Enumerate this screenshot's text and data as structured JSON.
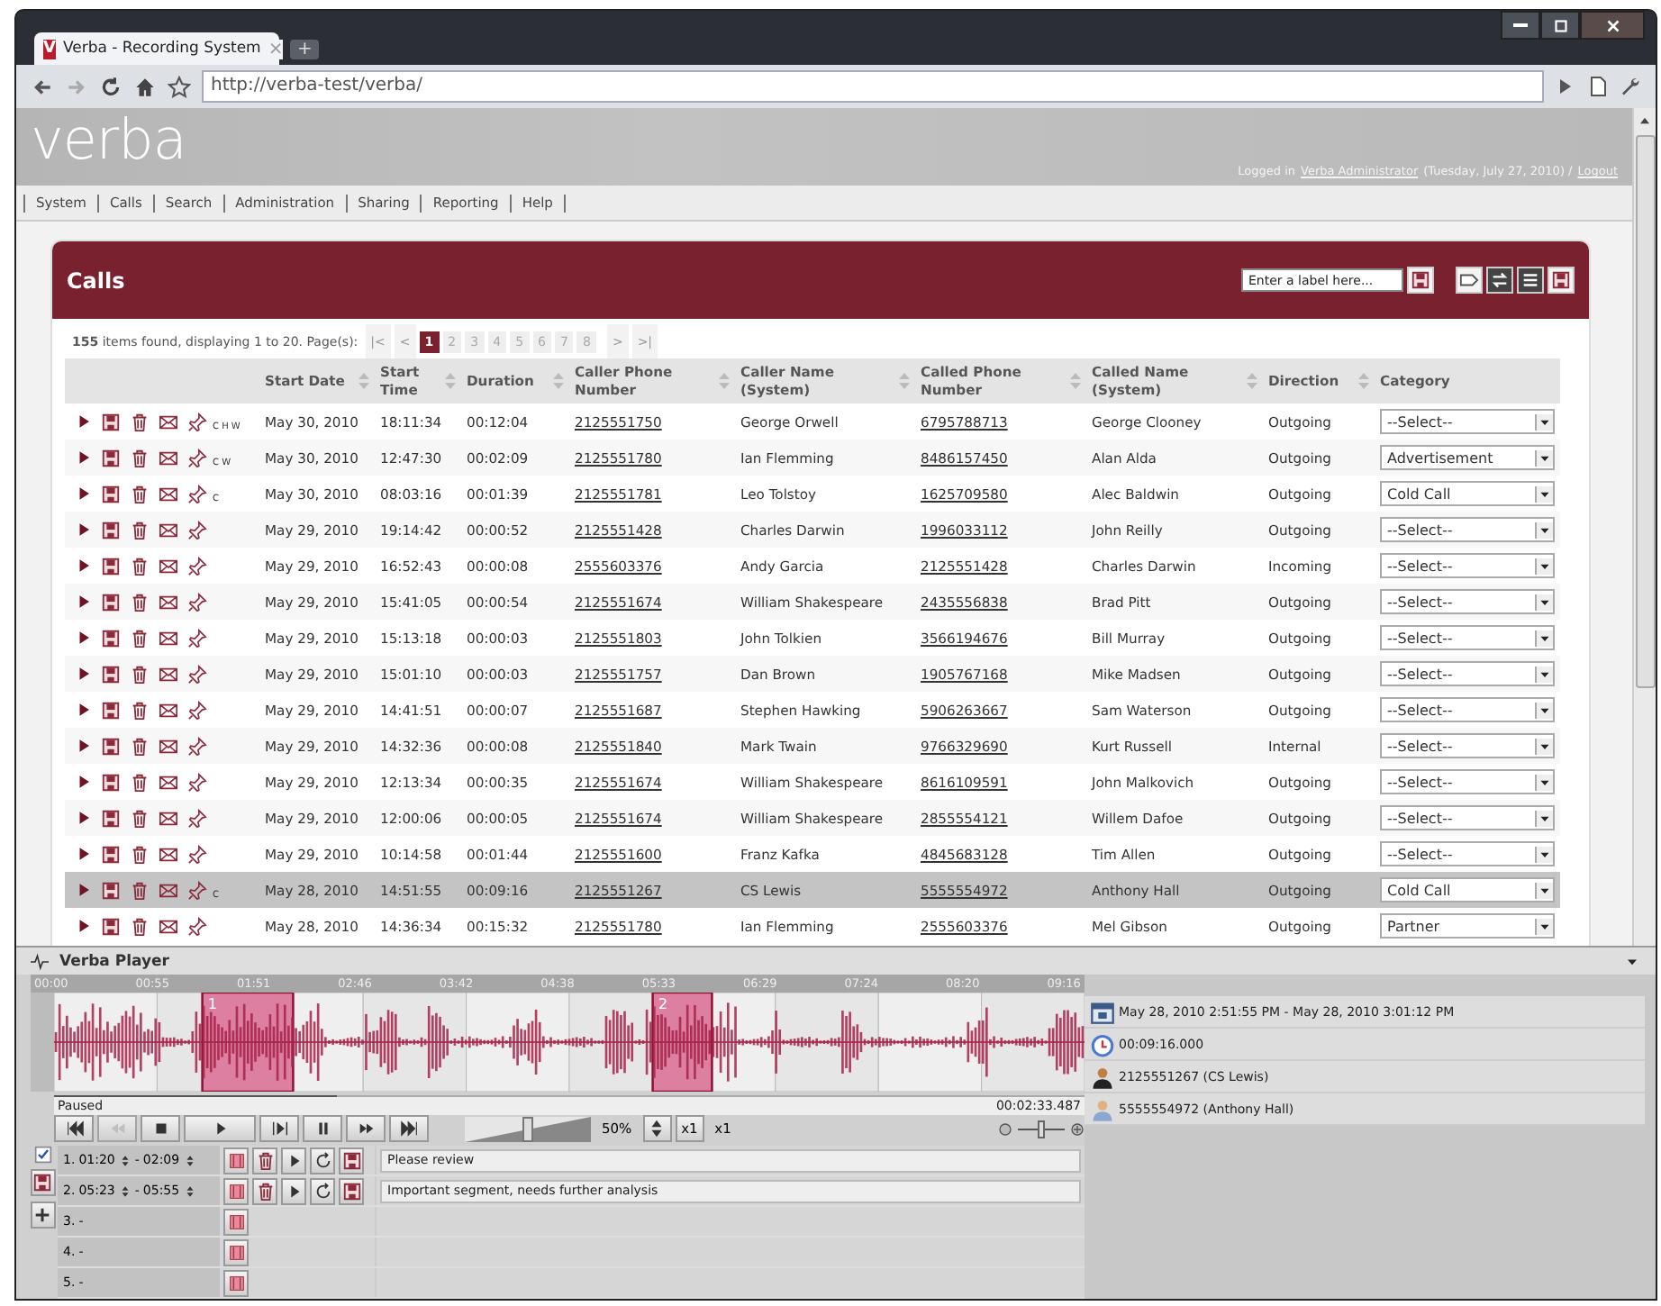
{
  "browser": {
    "tab_logo": "V",
    "tab_title": "Verba - Recording System",
    "tab_close": "×",
    "new_tab": "+",
    "url": "http://verba-test/verba/"
  },
  "header": {
    "logo": "verba",
    "logged_in": "Logged in",
    "user": "Verba Administrator",
    "date": "(Tuesday, July 27, 2010) /",
    "logout": "Logout"
  },
  "nav": [
    "System",
    "Calls",
    "Search",
    "Administration",
    "Sharing",
    "Reporting",
    "Help"
  ],
  "calls": {
    "title": "Calls",
    "label_field": {
      "placeholder": "Enter a label here..."
    },
    "summary": "**155** items found, displaying 1 to 20. Page(s):",
    "pager": [
      {
        "label": "|<",
        "kind": "nav",
        "selected": false
      },
      {
        "label": "<",
        "kind": "nav",
        "selected": false
      },
      {
        "label": "1",
        "kind": "page",
        "selected": true
      },
      {
        "label": "2",
        "kind": "page",
        "selected": false
      },
      {
        "label": "3",
        "kind": "page",
        "selected": false
      },
      {
        "label": "4",
        "kind": "page",
        "selected": false
      },
      {
        "label": "5",
        "kind": "page",
        "selected": false
      },
      {
        "label": "6",
        "kind": "page",
        "selected": false
      },
      {
        "label": "7",
        "kind": "page",
        "selected": false
      },
      {
        "label": "8",
        "kind": "page",
        "selected": false
      },
      {
        "label": ">",
        "kind": "nav",
        "selected": false
      },
      {
        "label": ">|",
        "kind": "nav",
        "selected": false
      }
    ],
    "columns": [
      {
        "label": "Start Date",
        "sortable": true
      },
      {
        "label": "Start Time",
        "sortable": true
      },
      {
        "label": "Duration",
        "sortable": true
      },
      {
        "label": "Caller Phone Number",
        "sortable": true
      },
      {
        "label": "Caller Name (System)",
        "sortable": true
      },
      {
        "label": "Called Phone Number",
        "sortable": true
      },
      {
        "label": "Called Name (System)",
        "sortable": true
      },
      {
        "label": "Direction",
        "sortable": true
      },
      {
        "label": "Category",
        "sortable": false
      }
    ],
    "rows": [
      {
        "flags": "C H W",
        "start_date": "May 30, 2010",
        "start_time": "18:11:34",
        "duration": "00:12:04",
        "caller_phone": "2125551750",
        "caller_name": "George Orwell",
        "called_phone": "6795788713",
        "called_name": "George Clooney",
        "direction": "Outgoing",
        "category": "--Select--",
        "selected": false
      },
      {
        "flags": "C W",
        "start_date": "May 30, 2010",
        "start_time": "12:47:30",
        "duration": "00:02:09",
        "caller_phone": "2125551780",
        "caller_name": "Ian Flemming",
        "called_phone": "8486157450",
        "called_name": "Alan Alda",
        "direction": "Outgoing",
        "category": "Advertisement",
        "selected": false
      },
      {
        "flags": "C",
        "start_date": "May 30, 2010",
        "start_time": "08:03:16",
        "duration": "00:01:39",
        "caller_phone": "2125551781",
        "caller_name": "Leo Tolstoy",
        "called_phone": "1625709580",
        "called_name": "Alec Baldwin",
        "direction": "Outgoing",
        "category": "Cold Call",
        "selected": false
      },
      {
        "start_date": "May 29, 2010",
        "start_time": "19:14:42",
        "duration": "00:00:52",
        "caller_phone": "2125551428",
        "caller_name": "Charles Darwin",
        "called_phone": "1996033112",
        "called_name": "John Reilly",
        "direction": "Outgoing",
        "category": "--Select--",
        "selected": false
      },
      {
        "start_date": "May 29, 2010",
        "start_time": "16:52:43",
        "duration": "00:00:08",
        "caller_phone": "2555603376",
        "caller_name": "Andy Garcia",
        "called_phone": "2125551428",
        "called_name": "Charles Darwin",
        "direction": "Incoming",
        "category": "--Select--",
        "selected": false
      },
      {
        "start_date": "May 29, 2010",
        "start_time": "15:41:05",
        "duration": "00:00:54",
        "caller_phone": "2125551674",
        "caller_name": "William Shakespeare",
        "called_phone": "2435556838",
        "called_name": "Brad Pitt",
        "direction": "Outgoing",
        "category": "--Select--",
        "selected": false
      },
      {
        "start_date": "May 29, 2010",
        "start_time": "15:13:18",
        "duration": "00:00:03",
        "caller_phone": "2125551803",
        "caller_name": "John Tolkien",
        "called_phone": "3566194676",
        "called_name": "Bill Murray",
        "direction": "Outgoing",
        "category": "--Select--",
        "selected": false
      },
      {
        "start_date": "May 29, 2010",
        "start_time": "15:01:10",
        "duration": "00:00:03",
        "caller_phone": "2125551757",
        "caller_name": "Dan Brown",
        "called_phone": "1905767168",
        "called_name": "Mike Madsen",
        "direction": "Outgoing",
        "category": "--Select--",
        "selected": false
      },
      {
        "start_date": "May 29, 2010",
        "start_time": "14:41:51",
        "duration": "00:00:07",
        "caller_phone": "2125551687",
        "caller_name": "Stephen Hawking",
        "called_phone": "5906263667",
        "called_name": "Sam Waterson",
        "direction": "Outgoing",
        "category": "--Select--",
        "selected": false
      },
      {
        "start_date": "May 29, 2010",
        "start_time": "14:32:36",
        "duration": "00:00:08",
        "caller_phone": "2125551840",
        "caller_name": "Mark Twain",
        "called_phone": "9766329690",
        "called_name": "Kurt Russell",
        "direction": "Internal",
        "category": "--Select--",
        "selected": false
      },
      {
        "start_date": "May 29, 2010",
        "start_time": "12:13:34",
        "duration": "00:00:35",
        "caller_phone": "2125551674",
        "caller_name": "William Shakespeare",
        "called_phone": "8616109591",
        "called_name": "John Malkovich",
        "direction": "Outgoing",
        "category": "--Select--",
        "selected": false
      },
      {
        "start_date": "May 29, 2010",
        "start_time": "12:00:06",
        "duration": "00:00:05",
        "caller_phone": "2125551674",
        "caller_name": "William Shakespeare",
        "called_phone": "2855554121",
        "called_name": "Willem Dafoe",
        "direction": "Outgoing",
        "category": "--Select--",
        "selected": false
      },
      {
        "start_date": "May 29, 2010",
        "start_time": "10:14:58",
        "duration": "00:01:44",
        "caller_phone": "2125551600",
        "caller_name": "Franz Kafka",
        "called_phone": "4845683128",
        "called_name": "Tim Allen",
        "direction": "Outgoing",
        "category": "--Select--",
        "selected": false
      },
      {
        "flags": "C",
        "start_date": "May 28, 2010",
        "start_time": "14:51:55",
        "duration": "00:09:16",
        "caller_phone": "2125551267",
        "caller_name": "CS Lewis",
        "called_phone": "5555554972",
        "called_name": "Anthony Hall",
        "direction": "Outgoing",
        "category": "Cold Call",
        "selected": true
      },
      {
        "start_date": "May 28, 2010",
        "start_time": "14:36:34",
        "duration": "00:15:32",
        "caller_phone": "2125551780",
        "caller_name": "Ian Flemming",
        "called_phone": "2555603376",
        "called_name": "Mel Gibson",
        "direction": "Outgoing",
        "category": "Partner",
        "selected": false
      }
    ]
  },
  "player": {
    "title": "Verba Player",
    "timeline": [
      "00:00",
      "00:55",
      "01:51",
      "02:46",
      "03:42",
      "04:38",
      "05:33",
      "06:29",
      "07:24",
      "08:20",
      "09:16"
    ],
    "progress": {
      "level": 0.275
    },
    "status": "Paused",
    "position": "00:02:33.487",
    "volume": {
      "level": 0.5,
      "reading": "50%"
    },
    "speed": {
      "button": "x1",
      "reading": "x1"
    },
    "zoom": {
      "level": 0.5
    },
    "segments_checked": true,
    "segments": [
      {
        "kind": "defined",
        "number": "1.",
        "start": "01:20",
        "separator": "-",
        "end": "02:09",
        "marker": "1",
        "note": "Please review"
      },
      {
        "kind": "defined",
        "number": "2.",
        "start": "05:23",
        "separator": "-",
        "end": "05:55",
        "marker": "2",
        "note": "Important segment, needs further analysis"
      },
      {
        "kind": "empty",
        "number": "3.",
        "separator": "-"
      },
      {
        "kind": "empty",
        "number": "4.",
        "separator": "-"
      },
      {
        "kind": "empty",
        "number": "5.",
        "separator": "-"
      }
    ],
    "info": [
      {
        "kind": "date",
        "text": "May 28, 2010 2:51:55 PM - May 28, 2010 3:01:12 PM"
      },
      {
        "kind": "duration",
        "text": "00:09:16.000"
      },
      {
        "kind": "caller",
        "text": "2125551267 (CS Lewis)"
      },
      {
        "kind": "called",
        "text": "5555554972 (Anthony Hall)"
      }
    ]
  }
}
